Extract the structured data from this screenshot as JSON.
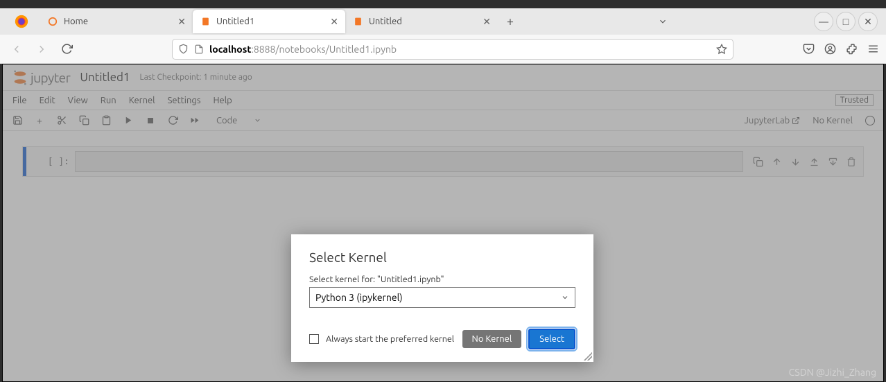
{
  "browser": {
    "tabs": [
      {
        "label": "Home"
      },
      {
        "label": "Untitled1"
      },
      {
        "label": "Untitled"
      }
    ],
    "url_host": "localhost",
    "url_port": ":8888",
    "url_path": "/notebooks/Untitled1.ipynb"
  },
  "jupyter": {
    "logo_text": "jupyter",
    "doc_title": "Untitled1",
    "checkpoint": "Last Checkpoint: 1 minute ago",
    "menus": {
      "file": "File",
      "edit": "Edit",
      "view": "View",
      "run": "Run",
      "kernel": "Kernel",
      "settings": "Settings",
      "help": "Help"
    },
    "trusted": "Trusted",
    "cell_type": "Code",
    "jlab_link": "JupyterLab",
    "kernel_status": "No Kernel",
    "prompt": "[  ]:"
  },
  "dialog": {
    "title": "Select Kernel",
    "label": "Select kernel for: \"Untitled1.ipynb\"",
    "selected": "Python 3 (ipykernel)",
    "checkbox_label": "Always start the preferred kernel",
    "btn_nokernel": "No Kernel",
    "btn_select": "Select"
  },
  "watermark": "CSDN @Jizhi_Zhang"
}
